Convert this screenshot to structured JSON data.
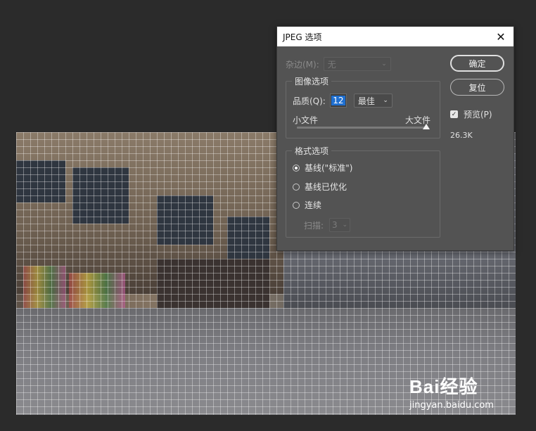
{
  "dialog": {
    "title": "JPEG 选项",
    "matte_label": "杂边(M):",
    "matte_value": "无",
    "image_options_legend": "图像选项",
    "quality_label": "品质(Q):",
    "quality_value": "12",
    "quality_preset": "最佳",
    "small_file_label": "小文件",
    "large_file_label": "大文件",
    "quality_slider_fraction": 1.0,
    "format_options_legend": "格式选项",
    "format_options": [
      {
        "label": "基线(\"标准\")",
        "selected": true
      },
      {
        "label": "基线已优化",
        "selected": false
      },
      {
        "label": "连续",
        "selected": false
      }
    ],
    "scans_label": "扫描:",
    "scans_value": "3",
    "ok_label": "确定",
    "reset_label": "复位",
    "preview_label": "预览(P)",
    "preview_checked": true,
    "file_size": "26.3K"
  },
  "watermark": {
    "brand": "Bai经验",
    "url": "jingyan.baidu.com"
  },
  "icons": {
    "close": "close-icon",
    "dropdown": "chevron-down-icon",
    "check": "checkmark-icon",
    "paw": "paw-logo"
  },
  "colors": {
    "app_background": "#2b2b2b",
    "dialog_background": "#535353",
    "highlight_input": "#1f6fd0"
  }
}
